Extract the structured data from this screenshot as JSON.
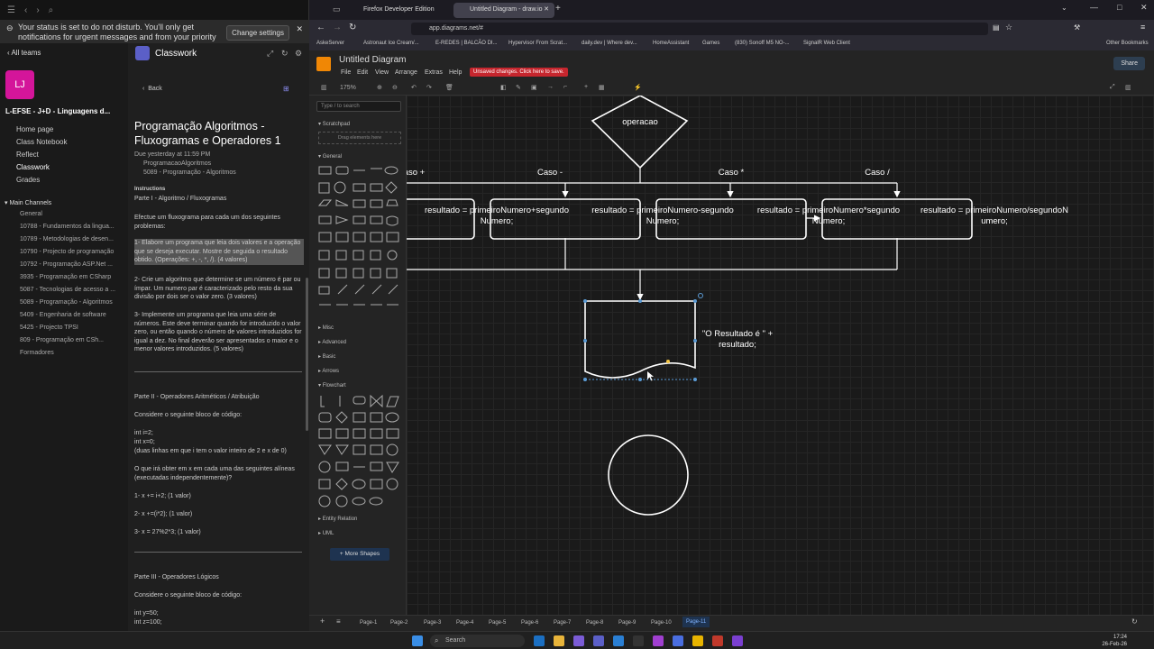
{
  "teams": {
    "dnd_text": "Your status is set to do not disturb. You'll only get notifications for urgent messages and from your priority contacts.",
    "change_settings": "Change settings",
    "all_teams": "All teams",
    "team_initials": "LJ",
    "team_name": "L-EFSE - J+D - Linguagens d...",
    "nav": [
      "Home page",
      "Class Notebook",
      "Reflect",
      "Classwork",
      "Grades"
    ],
    "main_channels": "Main Channels",
    "channels": [
      "General",
      "10788 - Fundamentos da lingua...",
      "10789 - Metodologias de desen...",
      "10790 - Projecto de programação",
      "10792 - Programação ASP.Net ...",
      "3935 - Programação em CSharp",
      "5087 - Tecnologias de acesso a ...",
      "5089 - Programação - Algoritmos",
      "5409 - Engenharia de software",
      "5425 - Projecto TPSI",
      "809 - Programação em CSh..."
    ],
    "formadores": "Formadores",
    "classwork_header": "Classwork",
    "back": "Back",
    "assign_title": "Programação Algoritmos - Fluxogramas e Operadores 1",
    "due": "Due yesterday at 11:59 PM",
    "category": "ProgramacaoAlgoritmos",
    "module": "5089 - Programação - Algoritmos",
    "instructions_label": "Instructions",
    "part1": "Parte I - Algoritmo / Fluxogramas",
    "p1_intro": "Efectue um fluxograma para cada um dos seguintes problemas:",
    "p1_item1": "1- Elabore um programa que leia dois valores e a operação que se deseja executar. Mostre de seguida o resultado obtido. (Operações: +, -, *, /). (4 valores)",
    "p1_item2": "2- Crie um algoritmo que determine se um número é par ou ímpar. Um numero par é caracterizado pelo resto da sua divisão por dois ser o valor zero. (3 valores)",
    "p1_item3": "3- Implemente um programa que leia uma série de números. Este deve terminar quando for introduzido o valor zero, ou então quando o número de valores introduzidos for igual a dez. No final deverão ser apresentados o maior e o menor valores introduzidos. (5 valores)",
    "part2": "Parte II - Operadores Aritméticos / Atribuição",
    "p2_intro": "Considere o seguinte bloco de código:",
    "p2_code1": "int i=2;",
    "p2_code2": "int x=0;",
    "p2_code3": "(duas linhas em que i tem o valor inteiro de 2 e x de 0)",
    "p2_q": "O que irá obter em x em cada uma das seguintes alíneas (executadas independentemente)?",
    "p2_a1": "1- x += i+2; (1 valor)",
    "p2_a2": "2- x +=(i*2); (1 valor)",
    "p2_a3": "3- x = 27%2*3; (1 valor)",
    "part3": "Parte III - Operadores Lógicos",
    "p3_intro": "Considere o seguinte bloco de código:",
    "p3_code1": "int y=50;",
    "p3_code2": "int z=100;"
  },
  "browser": {
    "tab1": "Firefox Developer Edition",
    "tab2": "Untitled Diagram - draw.io",
    "url": "app.diagrams.net/#",
    "bookmarks": [
      "AskeServer",
      "Astronaut Ice Cream/...",
      "E-REDES | BALCÃO DI...",
      "Hypervisor From Scrat...",
      "daily.dev | Where dev...",
      "HomeAssistant",
      "Games",
      "(830) Sonoff M5 NO-...",
      "SignalR Web Client",
      "Other Bookmarks"
    ]
  },
  "drawio": {
    "title": "Untitled Diagram",
    "menus": [
      "File",
      "Edit",
      "View",
      "Arrange",
      "Extras",
      "Help"
    ],
    "unsaved": "Unsaved changes. Click here to save.",
    "share": "Share",
    "zoom": "175%",
    "search_placeholder": "Type / to search",
    "scratchpad": "Scratchpad",
    "drag_here": "Drag elements here",
    "sections": [
      "General",
      "Misc",
      "Advanced",
      "Basic",
      "Arrows",
      "Flowchart",
      "Entity Relation",
      "UML"
    ],
    "more_shapes": "+ More Shapes",
    "pages": [
      "Page-1",
      "Page-2",
      "Page-3",
      "Page-4",
      "Page-5",
      "Page-6",
      "Page-7",
      "Page-8",
      "Page-9",
      "Page-10",
      "Page-11"
    ],
    "diagram": {
      "decision": "operacao",
      "cases": [
        "Caso +",
        "Caso -",
        "Caso *",
        "Caso /"
      ],
      "boxes": [
        "resultado = primeiroNumero+segundoNumero;",
        "resultado = primeiroNumero-segundoNumero;",
        "resultado = primeiroNumero*segundoNumero;",
        "resultado = primeiroNumero/segundoNumero;"
      ],
      "output": "\"O Resultado é \" + resultado;"
    }
  },
  "taskbar": {
    "search": "Search",
    "time": "17:24",
    "date": "26-Feb-26"
  }
}
